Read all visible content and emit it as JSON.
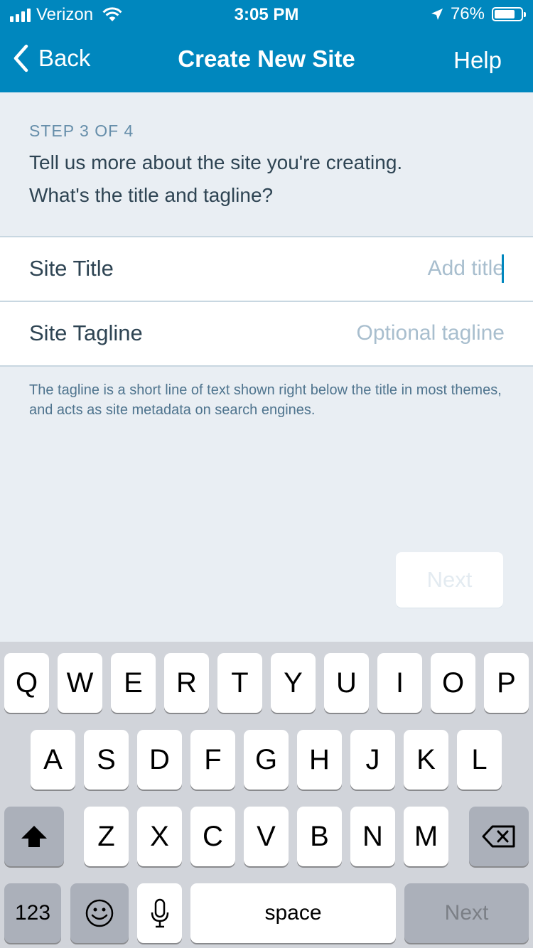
{
  "status_bar": {
    "carrier": "Verizon",
    "time": "3:05 PM",
    "battery": "76%",
    "battery_level": 0.76,
    "icons": [
      "signal-bars-icon",
      "wifi-icon",
      "location-arrow-icon",
      "battery-icon"
    ]
  },
  "nav": {
    "back_label": "Back",
    "title": "Create New Site",
    "help_label": "Help"
  },
  "content": {
    "step": "STEP 3 OF 4",
    "prompt_line1": "Tell us more about the site you're creating.",
    "prompt_line2": "What's the title and tagline?"
  },
  "form": {
    "title_label": "Site Title",
    "title_placeholder": "Add title",
    "title_value": "",
    "tagline_label": "Site Tagline",
    "tagline_placeholder": "Optional tagline",
    "tagline_value": ""
  },
  "hint": "The tagline is a short line of text shown right below the title in most themes, and acts as site metadata on search engines.",
  "next_button": "Next",
  "keyboard": {
    "row1": [
      "Q",
      "W",
      "E",
      "R",
      "T",
      "Y",
      "U",
      "I",
      "O",
      "P"
    ],
    "row2": [
      "A",
      "S",
      "D",
      "F",
      "G",
      "H",
      "J",
      "K",
      "L"
    ],
    "row3": [
      "Z",
      "X",
      "C",
      "V",
      "B",
      "N",
      "M"
    ],
    "numbers_label": "123",
    "space_label": "space",
    "return_label": "Next",
    "icons": [
      "shift-icon",
      "backspace-icon",
      "emoji-icon",
      "microphone-icon"
    ]
  },
  "colors": {
    "nav_background": "#0087be",
    "page_background": "#e9eef3",
    "label_text": "#2e4453",
    "placeholder_text": "#a8bece",
    "cursor": "#0087be"
  }
}
